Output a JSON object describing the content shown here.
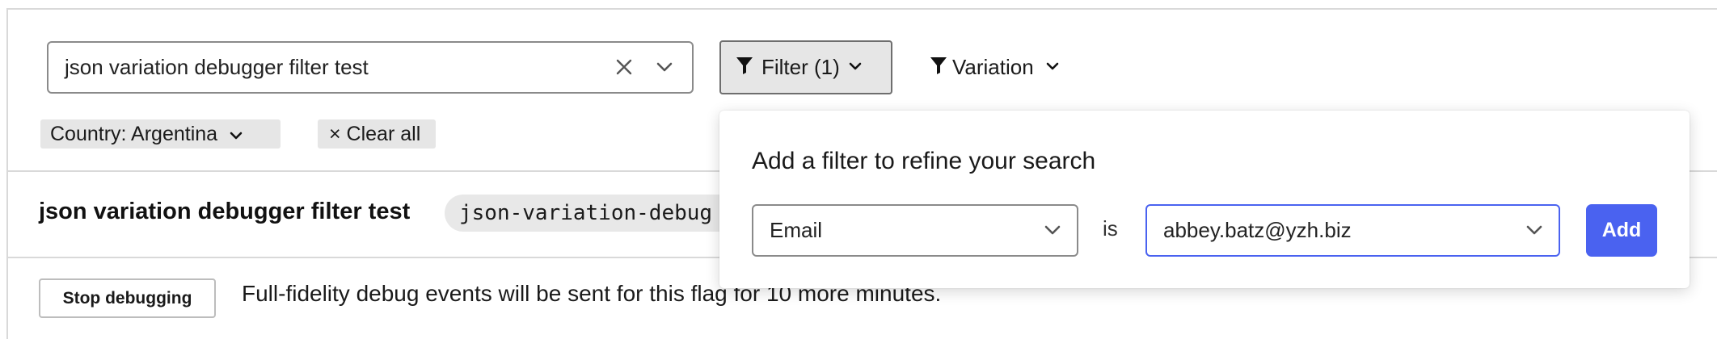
{
  "search": {
    "value": "json variation debugger filter test"
  },
  "toolbar": {
    "filter_label": "Filter (1)",
    "variation_label": "Variation"
  },
  "chips": {
    "country_label": "Country: Argentina",
    "clear_all_label": "× Clear all"
  },
  "flag": {
    "name": "json variation debugger filter test",
    "key": "json-variation-debug"
  },
  "debug": {
    "stop_label": "Stop debugging",
    "message": "Full-fidelity debug events will be sent for this flag for 10 more minutes."
  },
  "popover": {
    "title": "Add a filter to refine your search",
    "attribute_value": "Email",
    "operator": "is",
    "value": "abbey.batz@yzh.biz",
    "add_label": "Add"
  },
  "colors": {
    "accent": "#4a62f0",
    "chip_bg": "#e6e6e6",
    "border": "#d9d9d9"
  },
  "icons": [
    "close-icon",
    "chevron-down-icon",
    "filter-funnel-icon"
  ]
}
